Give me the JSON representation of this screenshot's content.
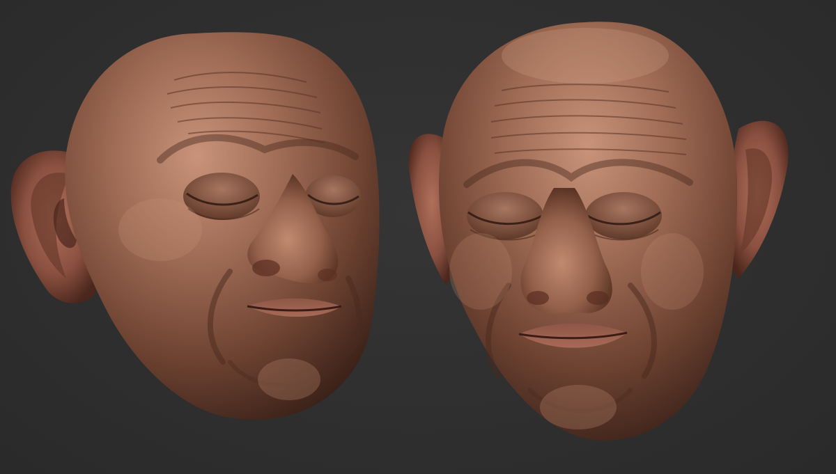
{
  "scene": {
    "background_color": "#2f2f2f",
    "skin_base_color": "#8a5a45",
    "skin_highlight_color": "#c48e72",
    "skin_shadow_color": "#3a2118",
    "lip_color": "#9c5e50",
    "subjects": [
      {
        "name": "head-sculpt-three-quarter-left",
        "view": "three-quarter",
        "eyes": "closed"
      },
      {
        "name": "head-sculpt-front",
        "view": "front",
        "eyes": "closed"
      }
    ]
  }
}
